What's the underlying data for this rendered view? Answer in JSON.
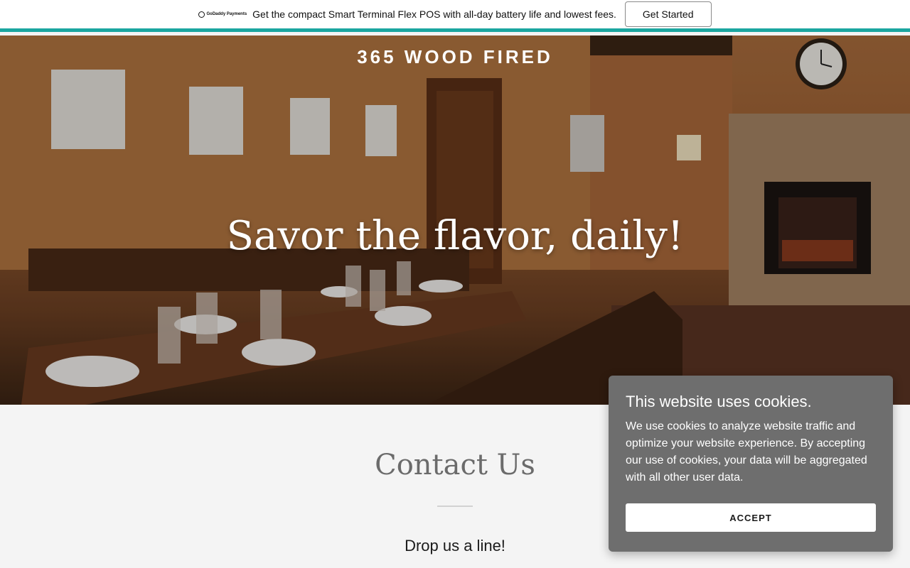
{
  "promo": {
    "logo_text": "GoDaddy Payments",
    "message": "Get the compact Smart Terminal Flex POS with all-day battery life and lowest fees.",
    "cta_label": "Get Started",
    "accent_color": "#1ba6a0"
  },
  "hero": {
    "brand": "365 WOOD FIRED",
    "tagline": "Savor the flavor, daily!"
  },
  "contact": {
    "title": "Contact Us",
    "subtitle": "Drop us a line!"
  },
  "cookie": {
    "title": "This website uses cookies.",
    "body": "We use cookies to analyze website traffic and optimize your website experience. By accepting our use of cookies, your data will be aggregated with all other user data.",
    "accept_label": "ACCEPT",
    "background_color": "#6e6e6e"
  }
}
